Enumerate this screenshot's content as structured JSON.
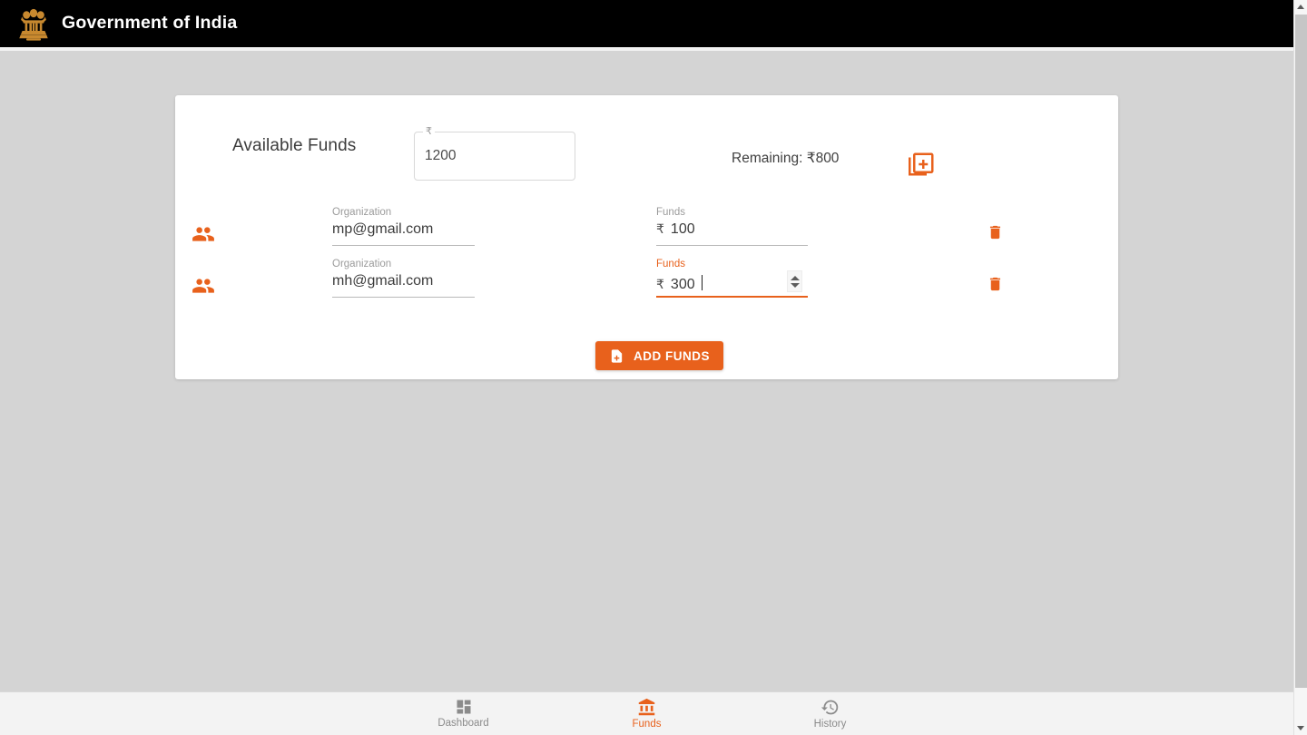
{
  "appbar": {
    "title": "Government of India",
    "emblem_icon": "national-emblem-icon",
    "background_color": "#000000",
    "emblem_color": "#c8892f"
  },
  "theme": {
    "accent": "#e8611c",
    "page_background": "#d4d4d4",
    "card_background": "#ffffff",
    "muted_text": "#9b9b9b"
  },
  "card": {
    "available_funds_label": "Available Funds",
    "available_funds_field": {
      "floating_label": "₹",
      "value": "1200",
      "placeholder": "Amount"
    },
    "remaining_text": "Remaining: ₹800",
    "add_row_icon": "library-add-icon",
    "rows": [
      {
        "person_icon": "people-icon",
        "organization_label": "Organization",
        "organization_value": "mp@gmail.com",
        "organization_placeholder": "Organization",
        "funds_label": "Funds",
        "funds_prefix": "₹",
        "funds_value": "100",
        "funds_placeholder": "Funds",
        "focused": false,
        "delete_icon": "trash-icon"
      },
      {
        "person_icon": "people-icon",
        "organization_label": "Organization",
        "organization_value": "mh@gmail.com",
        "organization_placeholder": "Organization",
        "funds_label": "Funds",
        "funds_prefix": "₹",
        "funds_value": "300",
        "funds_placeholder": "Funds",
        "focused": true,
        "delete_icon": "trash-icon"
      }
    ],
    "submit_button": {
      "label": "ADD FUNDS",
      "icon": "note-add-icon"
    }
  },
  "bottom_nav": {
    "items": [
      {
        "label": "Dashboard",
        "icon": "dashboard-icon",
        "active": false
      },
      {
        "label": "Funds",
        "icon": "account-balance-icon",
        "active": true
      },
      {
        "label": "History",
        "icon": "history-icon",
        "active": false
      }
    ]
  },
  "scrollbar": {
    "up_icon": "scroll-up-arrow-icon",
    "down_icon": "scroll-down-arrow-icon"
  }
}
